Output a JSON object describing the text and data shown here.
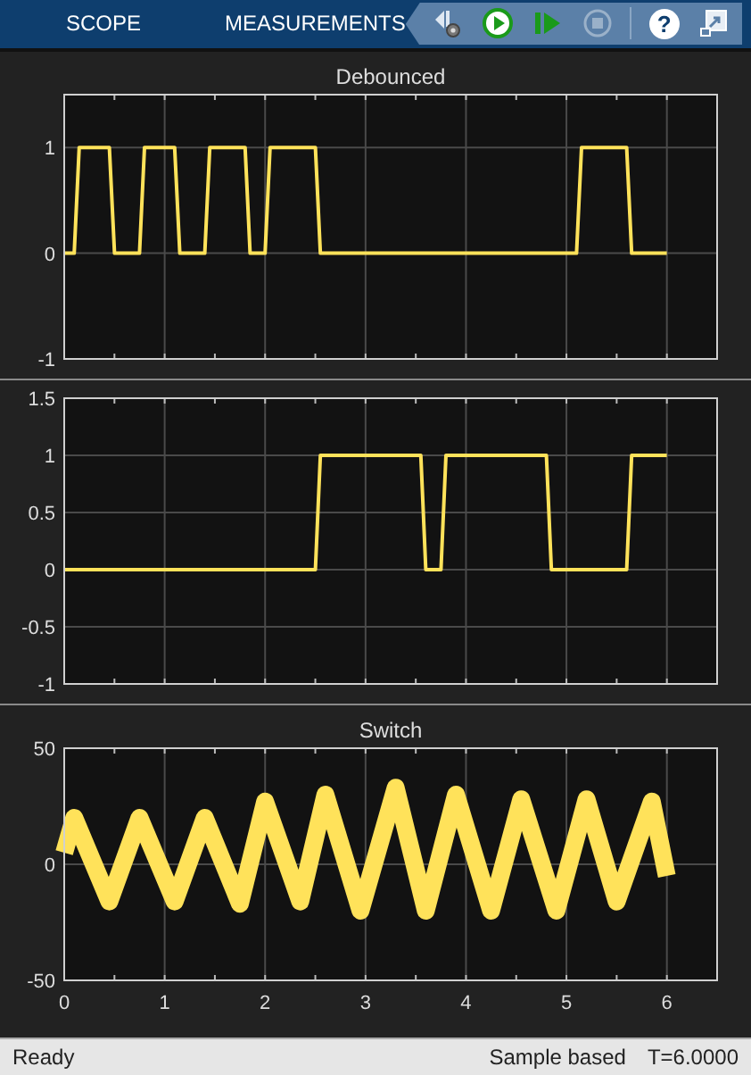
{
  "tabs": [
    {
      "label": "SCOPE"
    },
    {
      "label": "MEASUREMENTS"
    }
  ],
  "toolbar": [
    {
      "kind": "settings",
      "disabled": false
    },
    {
      "kind": "run",
      "disabled": false
    },
    {
      "kind": "step",
      "disabled": false
    },
    {
      "kind": "stop",
      "disabled": true
    },
    {
      "kind": "separator"
    },
    {
      "kind": "help",
      "glyph": "?",
      "disabled": false
    },
    {
      "kind": "undock",
      "disabled": false
    }
  ],
  "plots": [
    {
      "chart_data": {
        "type": "line",
        "title": "Debounced",
        "xlim": [
          0,
          6.5
        ],
        "ylim": [
          -1,
          1.5
        ],
        "yticks": [
          -1,
          0,
          1
        ],
        "x": [
          0,
          0.1,
          0.15,
          0.45,
          0.5,
          0.75,
          0.8,
          1.1,
          1.15,
          1.4,
          1.45,
          1.8,
          1.85,
          2.0,
          2.05,
          2.5,
          2.55,
          5.1,
          5.15,
          5.6,
          5.65,
          6.0
        ],
        "grid": true,
        "series": [
          {
            "color": "#ffe25a",
            "values": [
              0,
              0,
              1,
              1,
              0,
              0,
              1,
              1,
              0,
              0,
              1,
              1,
              0,
              0,
              1,
              1,
              0,
              0,
              1,
              1,
              0,
              0
            ]
          }
        ]
      }
    },
    {
      "chart_data": {
        "type": "line",
        "xlim": [
          0,
          6.5
        ],
        "ylim": [
          -1,
          1.5
        ],
        "yticks": [
          -1,
          -0.5,
          0,
          0.5,
          1,
          1.5
        ],
        "x": [
          0,
          2.5,
          2.55,
          3.55,
          3.6,
          3.75,
          3.8,
          4.8,
          4.85,
          5.6,
          5.65,
          6.0
        ],
        "grid": true,
        "series": [
          {
            "color": "#ffe25a",
            "values": [
              0,
              0,
              1,
              1,
              0,
              0,
              1,
              1,
              0,
              0,
              1,
              1
            ]
          }
        ]
      }
    },
    {
      "chart_data": {
        "type": "line",
        "title": "Switch",
        "xlim": [
          0,
          6.5
        ],
        "ylim": [
          -50,
          50
        ],
        "yticks": [
          -50,
          0,
          50
        ],
        "xticks": [
          0,
          1,
          2,
          3,
          4,
          5,
          6
        ],
        "x": [
          0,
          0.1,
          0.45,
          0.75,
          1.1,
          1.4,
          1.75,
          2.0,
          2.35,
          2.6,
          2.95,
          3.3,
          3.6,
          3.9,
          4.25,
          4.55,
          4.9,
          5.2,
          5.5,
          5.85,
          6.0
        ],
        "grid": true,
        "series": [
          {
            "color": "#ffe25a",
            "values": [
              5,
              20,
              -16,
              20,
              -16,
              20,
              -17,
              27,
              -16,
              30,
              -20,
              33,
              -20,
              30,
              -20,
              28,
              -20,
              28,
              -16,
              27,
              -5
            ]
          }
        ]
      }
    }
  ],
  "status_bar": {
    "left": "Ready",
    "mode": "Sample based",
    "time": "T=6.0000"
  }
}
